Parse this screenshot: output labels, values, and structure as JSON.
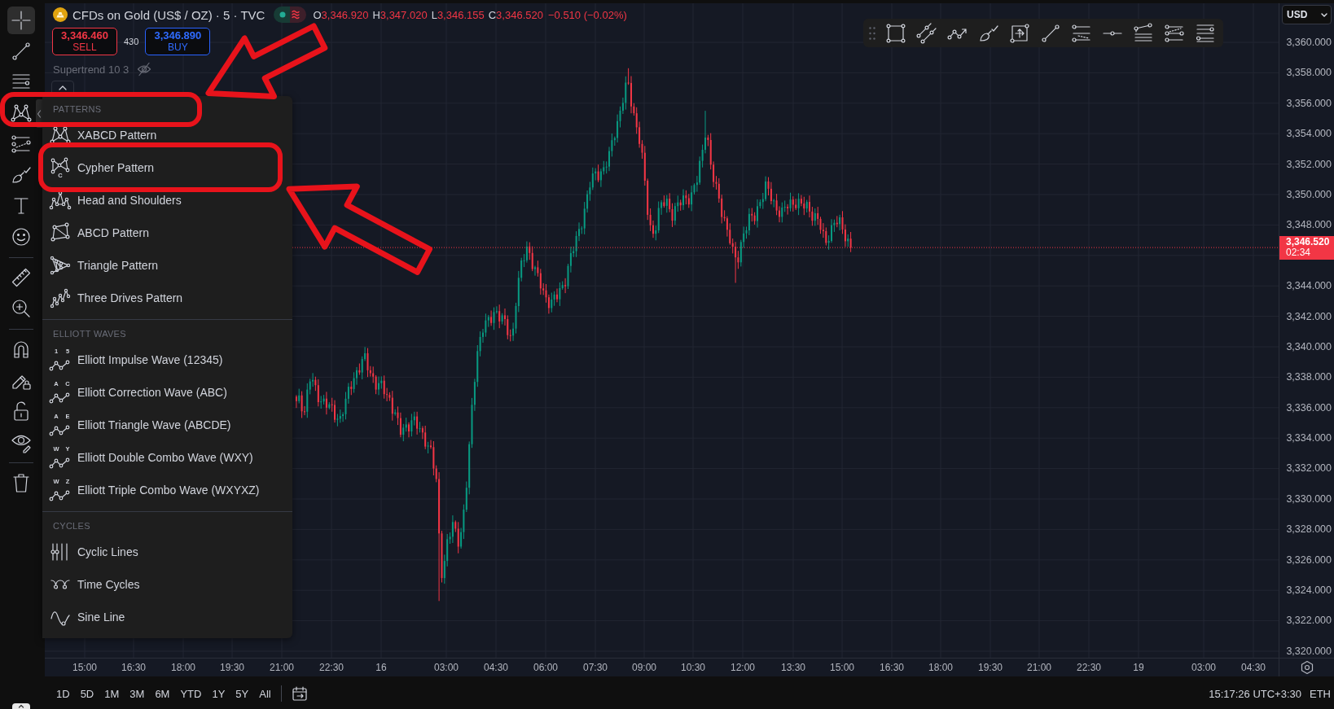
{
  "left_toolbar": {
    "tool_groups": [
      [
        {
          "selected": true
        },
        {
          "selected": false
        },
        {
          "selected": false
        },
        {
          "selected": false
        },
        {
          "selected": false
        },
        {
          "selected": false
        },
        {
          "selected": false
        },
        {
          "selected": false
        }
      ],
      [
        {
          "selected": false
        },
        {
          "selected": false
        }
      ],
      [
        {
          "selected": false
        },
        {
          "selected": false
        },
        {
          "selected": false
        },
        {
          "selected": false
        }
      ],
      [
        {
          "selected": false
        }
      ]
    ]
  },
  "symbol_legend": {
    "title": "CFDs on Gold (US$ / OZ) · 5 · TVC",
    "falling": true,
    "ohlc": [
      {
        "label": "O",
        "value": "3,346.920"
      },
      {
        "label": "H",
        "value": "3,347.020"
      },
      {
        "label": "L",
        "value": "3,346.155"
      },
      {
        "label": "C",
        "value": "3,346.520"
      }
    ],
    "change": "−0.510 (−0.02%)"
  },
  "trade_panel": {
    "sell": {
      "price": "3,346.460",
      "label": "SELL"
    },
    "spread": "430",
    "buy": {
      "price": "3,346.890",
      "label": "BUY"
    }
  },
  "indicators": [
    {
      "name": "Supertrend 10 3",
      "hidden": true
    }
  ],
  "drawing_menu": {
    "sections": [
      {
        "title": "PATTERNS",
        "items": [
          {
            "label": "XABCD Pattern"
          },
          {
            "label": "Cypher Pattern",
            "icon_text": [
              "C"
            ]
          },
          {
            "label": "Head and Shoulders"
          },
          {
            "label": "ABCD Pattern"
          },
          {
            "label": "Triangle Pattern"
          },
          {
            "label": "Three Drives Pattern"
          }
        ]
      },
      {
        "title": "ELLIOTT WAVES",
        "items": [
          {
            "label": "Elliott Impulse Wave (12345)",
            "icon_text": [
              "1",
              "5"
            ]
          },
          {
            "label": "Elliott Correction Wave (ABC)",
            "icon_text": [
              "A",
              "C"
            ]
          },
          {
            "label": "Elliott Triangle Wave (ABCDE)",
            "icon_text": [
              "A",
              "E"
            ]
          },
          {
            "label": "Elliott Double Combo Wave (WXY)",
            "icon_text": [
              "W",
              "Y"
            ]
          },
          {
            "label": "Elliott Triple Combo Wave (WXYXZ)",
            "icon_text": [
              "W",
              "Z"
            ]
          }
        ]
      },
      {
        "title": "CYCLES",
        "items": [
          {
            "label": "Cyclic Lines"
          },
          {
            "label": "Time Cycles"
          },
          {
            "label": "Sine Line"
          }
        ]
      }
    ]
  },
  "price_axis": {
    "currency": "USD",
    "scale": [
      {
        "kind": "label",
        "text": "3,360.000"
      },
      {
        "kind": "label",
        "text": "3,358.000"
      },
      {
        "kind": "label",
        "text": "3,356.000"
      },
      {
        "kind": "label",
        "text": "3,354.000"
      },
      {
        "kind": "label",
        "text": "3,352.000"
      },
      {
        "kind": "label",
        "text": "3,350.000"
      },
      {
        "kind": "label",
        "text": "3,348.000"
      },
      {
        "kind": "current",
        "price": "3,346.520",
        "countdown": "02:34"
      },
      {
        "kind": "label",
        "text": "3,344.000"
      },
      {
        "kind": "label",
        "text": "3,342.000"
      },
      {
        "kind": "label",
        "text": "3,340.000"
      },
      {
        "kind": "label",
        "text": "3,338.000"
      },
      {
        "kind": "label",
        "text": "3,336.000"
      },
      {
        "kind": "label",
        "text": "3,334.000"
      },
      {
        "kind": "label",
        "text": "3,332.000"
      },
      {
        "kind": "label",
        "text": "3,330.000"
      },
      {
        "kind": "label",
        "text": "3,328.000"
      },
      {
        "kind": "label",
        "text": "3,326.000"
      },
      {
        "kind": "label",
        "text": "3,324.000"
      },
      {
        "kind": "label",
        "text": "3,322.000"
      },
      {
        "kind": "label",
        "text": "3,320.000"
      }
    ]
  },
  "time_axis": {
    "labels": [
      "15:00",
      "16:30",
      "18:00",
      "19:30",
      "21:00",
      "22:30",
      "16",
      "03:00",
      "04:30",
      "06:00",
      "07:30",
      "09:00",
      "10:30",
      "12:00",
      "13:30",
      "15:00",
      "16:30",
      "18:00",
      "19:30",
      "21:00",
      "22:30",
      "19",
      "03:00",
      "04:30"
    ]
  },
  "bottom_bar": {
    "ranges": [
      "1D",
      "5D",
      "1M",
      "3M",
      "6M",
      "YTD",
      "1Y",
      "5Y",
      "All"
    ],
    "clock": "15:17:26 UTC+3:30",
    "session": "ETH"
  }
}
